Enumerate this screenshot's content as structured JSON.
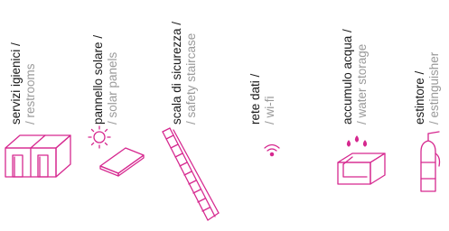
{
  "items": [
    {
      "it": "servizi igienici /",
      "en": "/ restrooms",
      "icon": "restroom-icon"
    },
    {
      "it": "pannello solare /",
      "en": "/ solar panels",
      "icon": "solar-panel-icon"
    },
    {
      "it": "scala di sicurezza /",
      "en": "/ safety staircase",
      "icon": "staircase-icon"
    },
    {
      "it": "rete dati /",
      "en": "/ wi-fi",
      "icon": "wifi-icon"
    },
    {
      "it": "accumulo acqua /",
      "en": "/ water storage",
      "icon": "water-tank-icon"
    },
    {
      "it": "estintore /",
      "en": "/ estinguisher",
      "icon": "extinguisher-icon"
    }
  ],
  "colors": {
    "accent": "#d6288f",
    "text": "#1a1a1a",
    "subtext": "#9a9a9a"
  }
}
